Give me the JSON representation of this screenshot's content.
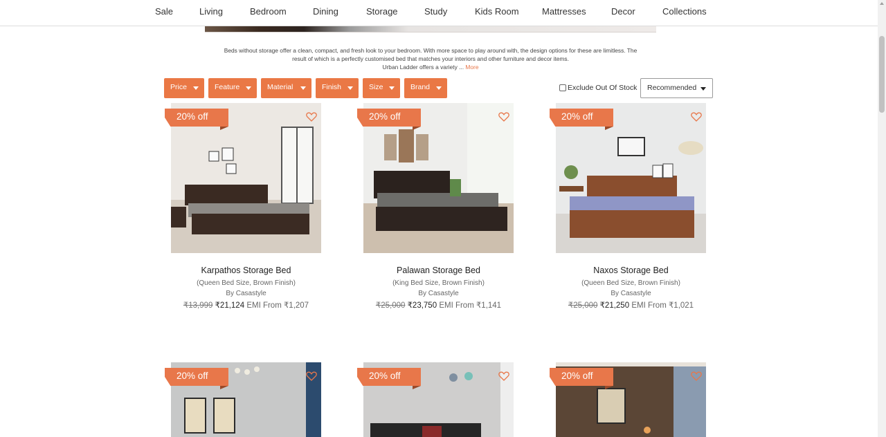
{
  "nav": {
    "items": [
      "Sale",
      "Living",
      "Bedroom",
      "Dining",
      "Storage",
      "Study",
      "Kids Room",
      "Mattresses",
      "Decor",
      "Collections"
    ]
  },
  "description": {
    "line1": "Beds without storage offer a clean, compact, and fresh look to your bedroom. With more space to play around with, the design options for these are limitless. The",
    "line2": "result of which is a perfectly customised bed that matches your interiors and other furniture and decor items.",
    "line3": "Urban Ladder offers a variety ...",
    "more_link": "More"
  },
  "filters": [
    "Price",
    "Feature",
    "Material",
    "Finish",
    "Size",
    "Brand"
  ],
  "exclude_out_of_stock": {
    "label": "Exclude Out Of Stock",
    "checked": false
  },
  "sort": {
    "selected": "Recommended"
  },
  "products": [
    {
      "discount": "20% off",
      "name": "Karpathos Storage Bed",
      "variant": "(Queen Bed Size, Brown Finish)",
      "brand": "By Casastyle",
      "mrp": "₹13,999",
      "price": "₹21,124",
      "emi": "EMI From ₹1,207"
    },
    {
      "discount": "20% off",
      "name": "Palawan Storage Bed",
      "variant": "(King Bed Size, Brown Finish)",
      "brand": "By Casastyle",
      "mrp": "₹25,000",
      "price": "₹23,750",
      "emi": "EMI From ₹1,141"
    },
    {
      "discount": "20% off",
      "name": "Naxos Storage Bed",
      "variant": "(Queen Bed Size, Brown Finish)",
      "brand": "By Casastyle",
      "mrp": "₹25,000",
      "price": "₹21,250",
      "emi": "EMI From ₹1,021"
    },
    {
      "discount": "20% off"
    },
    {
      "discount": "20% off"
    },
    {
      "discount": "20% off"
    }
  ],
  "colors": {
    "accent": "#ea7845",
    "border": "#dcdcdc"
  },
  "icons": {
    "wishlist": "heart-outline-icon",
    "dropdown": "caret-down-icon"
  }
}
